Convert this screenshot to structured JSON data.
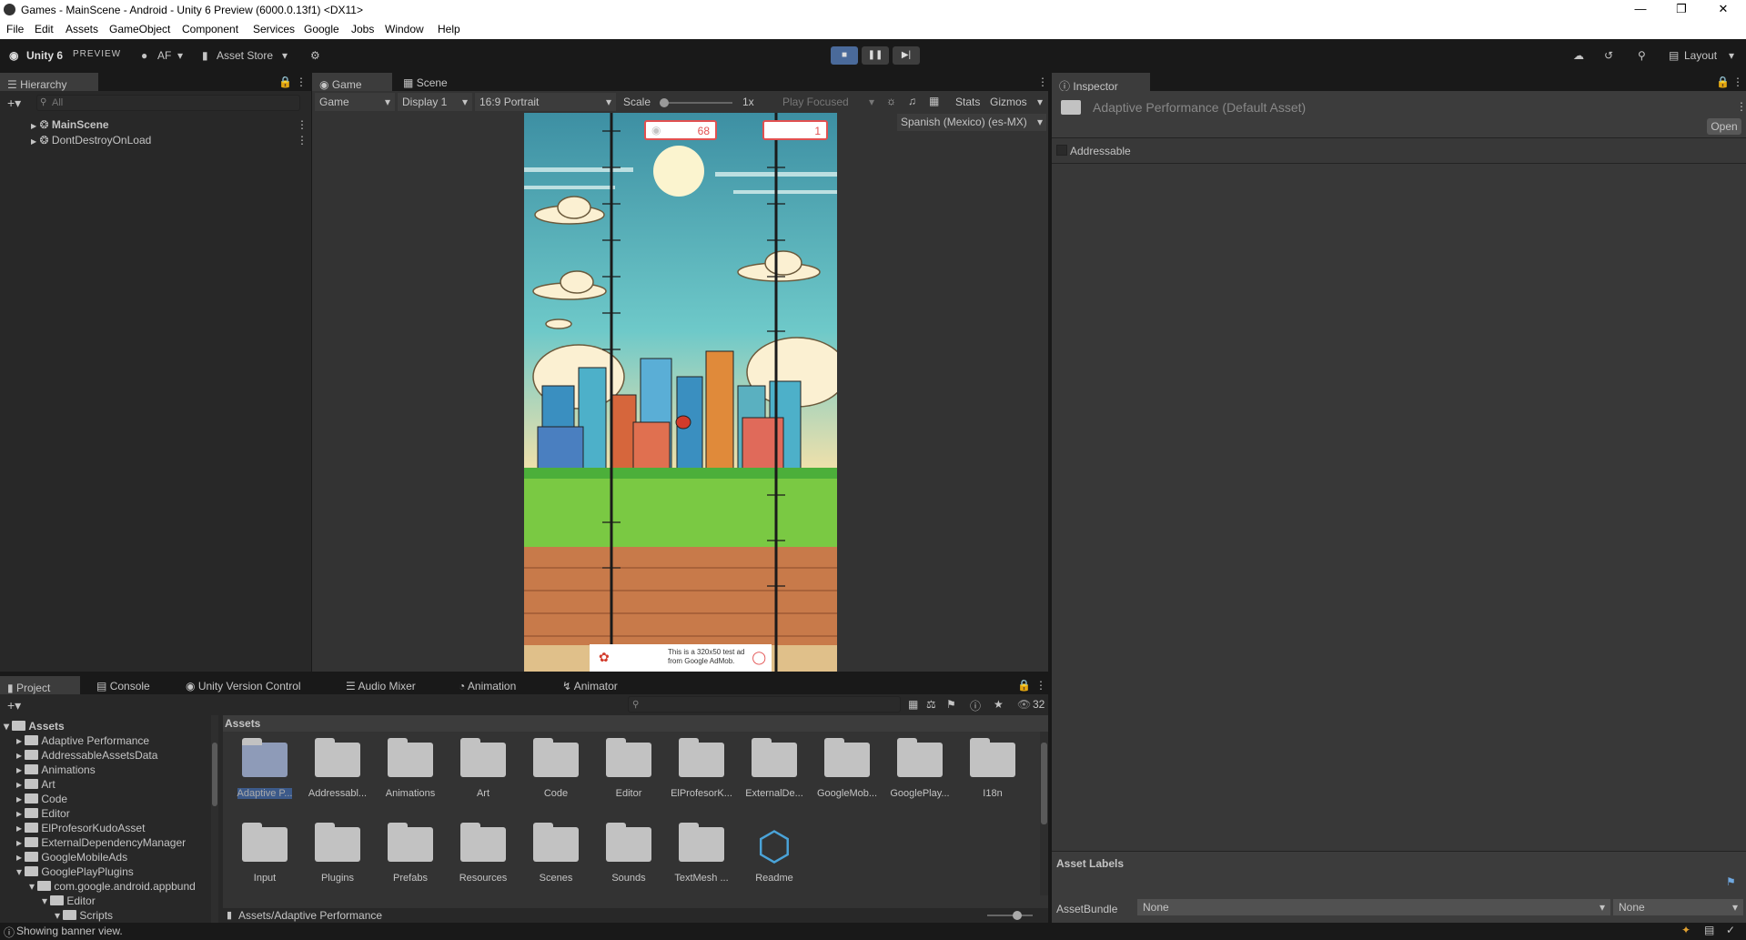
{
  "window": {
    "title": "Games - MainScene - Android - Unity 6 Preview (6000.0.13f1) <DX11>"
  },
  "menu": [
    "File",
    "Edit",
    "Assets",
    "GameObject",
    "Component",
    "Services",
    "Google",
    "Jobs",
    "Window",
    "Help"
  ],
  "toolbar": {
    "brand": "Unity 6",
    "brand_suffix": "PREVIEW",
    "account": "AF",
    "asset_store": "Asset Store",
    "layout": "Layout"
  },
  "hierarchy": {
    "tab": "Hierarchy",
    "search_placeholder": "All",
    "items": [
      "MainScene",
      "DontDestroyOnLoad"
    ]
  },
  "game_view": {
    "tab_game": "Game",
    "tab_scene": "Scene",
    "mode": "Game",
    "display": "Display 1",
    "aspect": "16:9 Portrait",
    "scale_label": "Scale",
    "scale_value": "1x",
    "play_focused": "Play Focused",
    "stats": "Stats",
    "gizmos": "Gizmos",
    "locale": "Spanish (Mexico) (es-MX)",
    "score": "68",
    "lives": "1",
    "ad_text": "This is a 320x50 test ad from Google AdMob."
  },
  "inspector": {
    "tab": "Inspector",
    "asset_title": "Adaptive Performance (Default Asset)",
    "open": "Open",
    "addressable": "Addressable",
    "labels_title": "Asset Labels",
    "assetbundle_label": "AssetBundle",
    "bundle_value": "None",
    "variant_value": "None"
  },
  "project": {
    "tabs": [
      "Project",
      "Console",
      "Unity Version Control",
      "Audio Mixer",
      "Animation",
      "Animator"
    ],
    "count": "32",
    "root": "Assets",
    "breadcrumb": "Assets",
    "path": "Assets/Adaptive Performance",
    "tree": [
      "Adaptive Performance",
      "AddressableAssetsData",
      "Animations",
      "Art",
      "Code",
      "Editor",
      "ElProfesorKudoAsset",
      "ExternalDependencyManager",
      "GoogleMobileAds",
      "GooglePlayPlugins",
      "com.google.android.appbund",
      "Editor",
      "Scripts"
    ],
    "grid": [
      "Adaptive P...",
      "Addressabl...",
      "Animations",
      "Art",
      "Code",
      "Editor",
      "ElProfesorK...",
      "ExternalDe...",
      "GoogleMob...",
      "GooglePlay...",
      "I18n",
      "Input",
      "Plugins",
      "Prefabs",
      "Resources",
      "Scenes",
      "Sounds",
      "TextMesh ...",
      "Readme"
    ]
  },
  "status": {
    "message": "Showing banner view."
  }
}
